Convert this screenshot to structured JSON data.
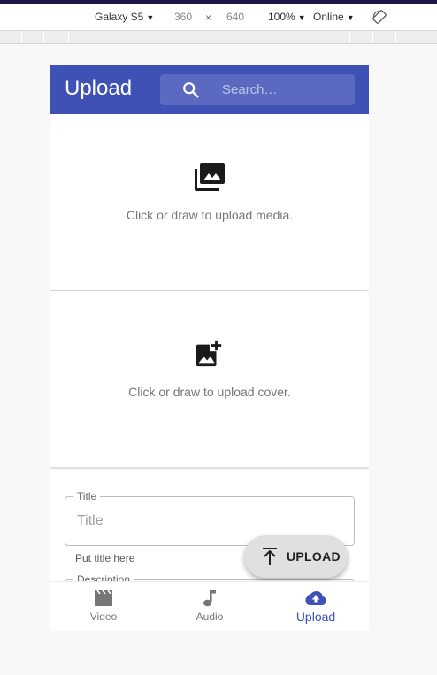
{
  "devtools": {
    "device": "Galaxy S5",
    "width": "360",
    "times": "×",
    "height": "640",
    "zoom": "100%",
    "network": "Online"
  },
  "app_bar": {
    "title": "Upload",
    "search_placeholder": "Search…"
  },
  "media_zone": {
    "text": "Click or draw to upload media."
  },
  "cover_zone": {
    "text": "Click or draw to upload cover."
  },
  "form": {
    "title_legend": "Title",
    "title_placeholder": "Title",
    "title_helper": "Put title here",
    "description_legend": "Description"
  },
  "fab": {
    "label": "UPLOAD"
  },
  "bottom_nav": {
    "items": [
      {
        "label": "Video",
        "icon": "movie-icon"
      },
      {
        "label": "Audio",
        "icon": "music-note-icon"
      },
      {
        "label": "Upload",
        "icon": "cloud-upload-icon"
      }
    ],
    "active": "Upload"
  },
  "colors": {
    "primary": "#3f51b5",
    "topbar_strip": "#1f1549"
  }
}
